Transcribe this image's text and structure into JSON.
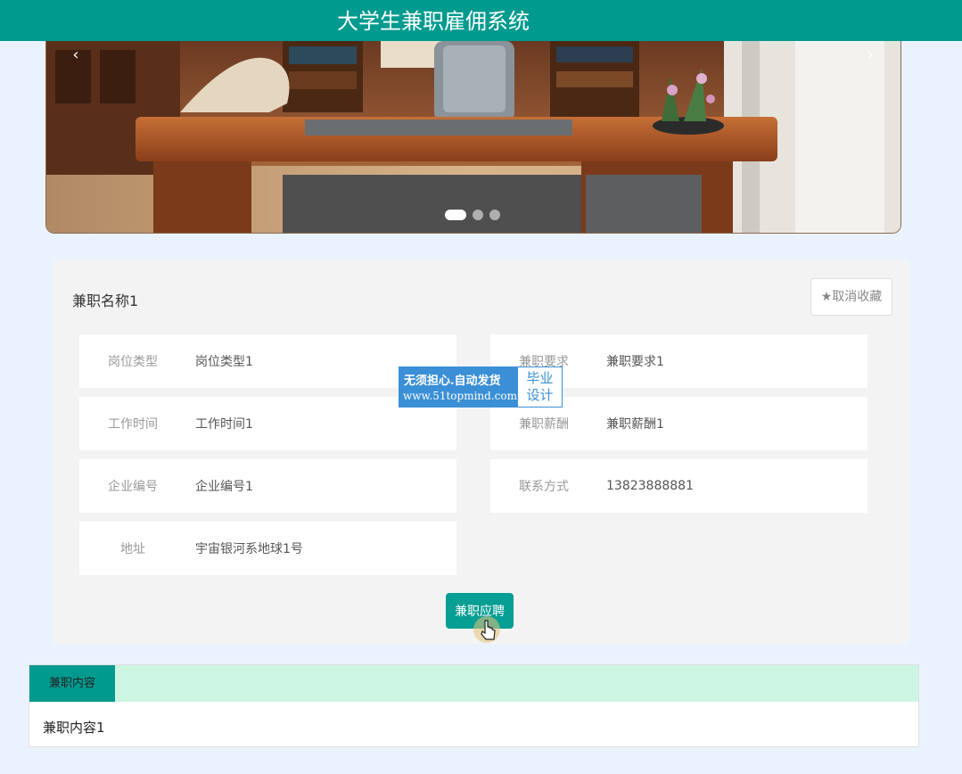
{
  "header": {
    "title": "大学生兼职雇佣系统"
  },
  "carousel": {
    "prev_icon": "chevron-left-icon",
    "next_icon": "chevron-right-icon",
    "prev_glyph": "‹",
    "next_glyph": "›",
    "slide_count": 3,
    "active_slide": 1
  },
  "detail": {
    "title": "兼职名称1",
    "favorite_label": "★取消收藏",
    "fields": [
      {
        "label": "岗位类型",
        "value": "岗位类型1"
      },
      {
        "label": "兼职要求",
        "value": "兼职要求1"
      },
      {
        "label": "工作时间",
        "value": "工作时间1"
      },
      {
        "label": "兼职薪酬",
        "value": "兼职薪酬1"
      },
      {
        "label": "企业编号",
        "value": "企业编号1"
      },
      {
        "label": "联系方式",
        "value": "13823888881"
      },
      {
        "label": "地址",
        "value": "宇宙银河系地球1号"
      }
    ],
    "apply_label": "兼职应聘"
  },
  "watermark": {
    "line1": "无须担心.自动发货",
    "line2": "www.51topmind.com",
    "right1": "毕业",
    "right2": "设计"
  },
  "content": {
    "tab_label": "兼职内容",
    "text": "兼职内容1"
  },
  "colors": {
    "header": "#009a8f",
    "button": "#079e93",
    "tab_bar": "#cdf6e2",
    "page_bg": "#eaf3fd"
  }
}
